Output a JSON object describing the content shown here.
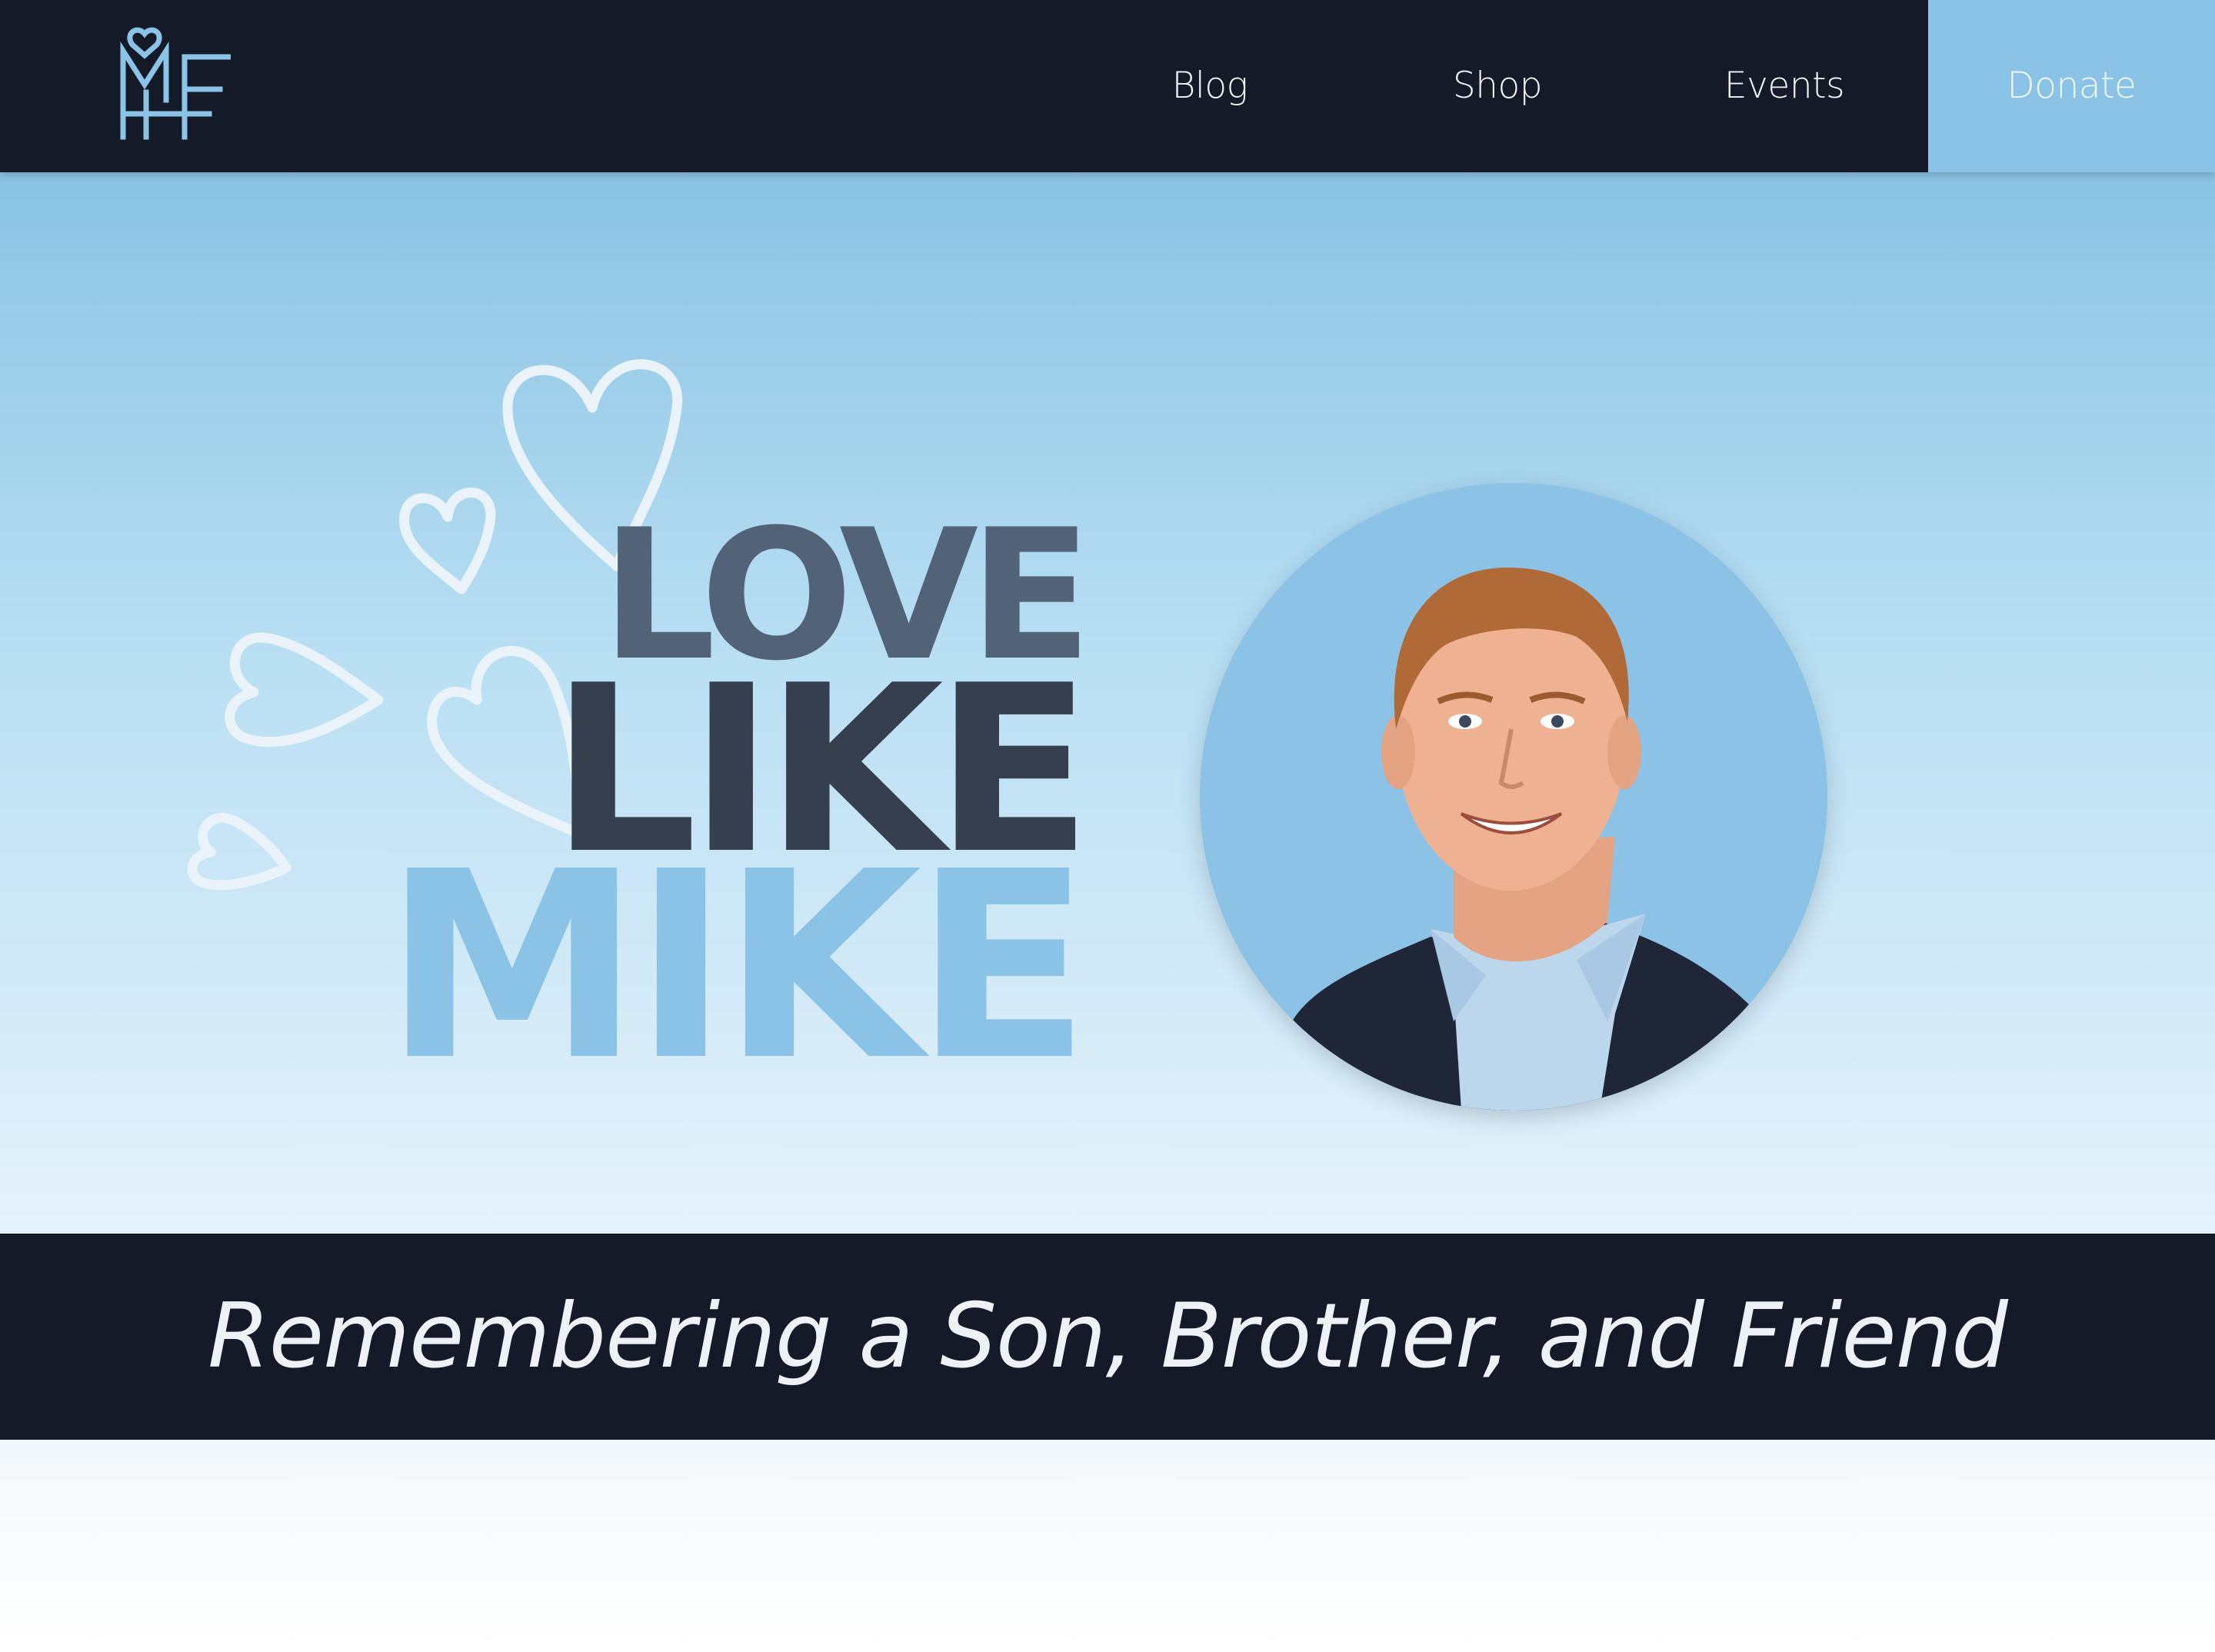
{
  "nav": {
    "logo_alt": "MHF",
    "links": [
      {
        "label": "Blog"
      },
      {
        "label": "Shop"
      },
      {
        "label": "Events"
      }
    ],
    "donate_label": "Donate"
  },
  "hero": {
    "line1": "LOVE",
    "line2": "LIKE",
    "line3": "MIKE",
    "portrait_icon": "person-portrait-icon",
    "hearts_icon": "outline-hearts-icon"
  },
  "tagline": "Remembering a Son, Brother, and Friend",
  "colors": {
    "nav_bg": "#141a28",
    "accent": "#8ac3e6",
    "love_text": "#526377",
    "like_text": "#353f4e"
  }
}
